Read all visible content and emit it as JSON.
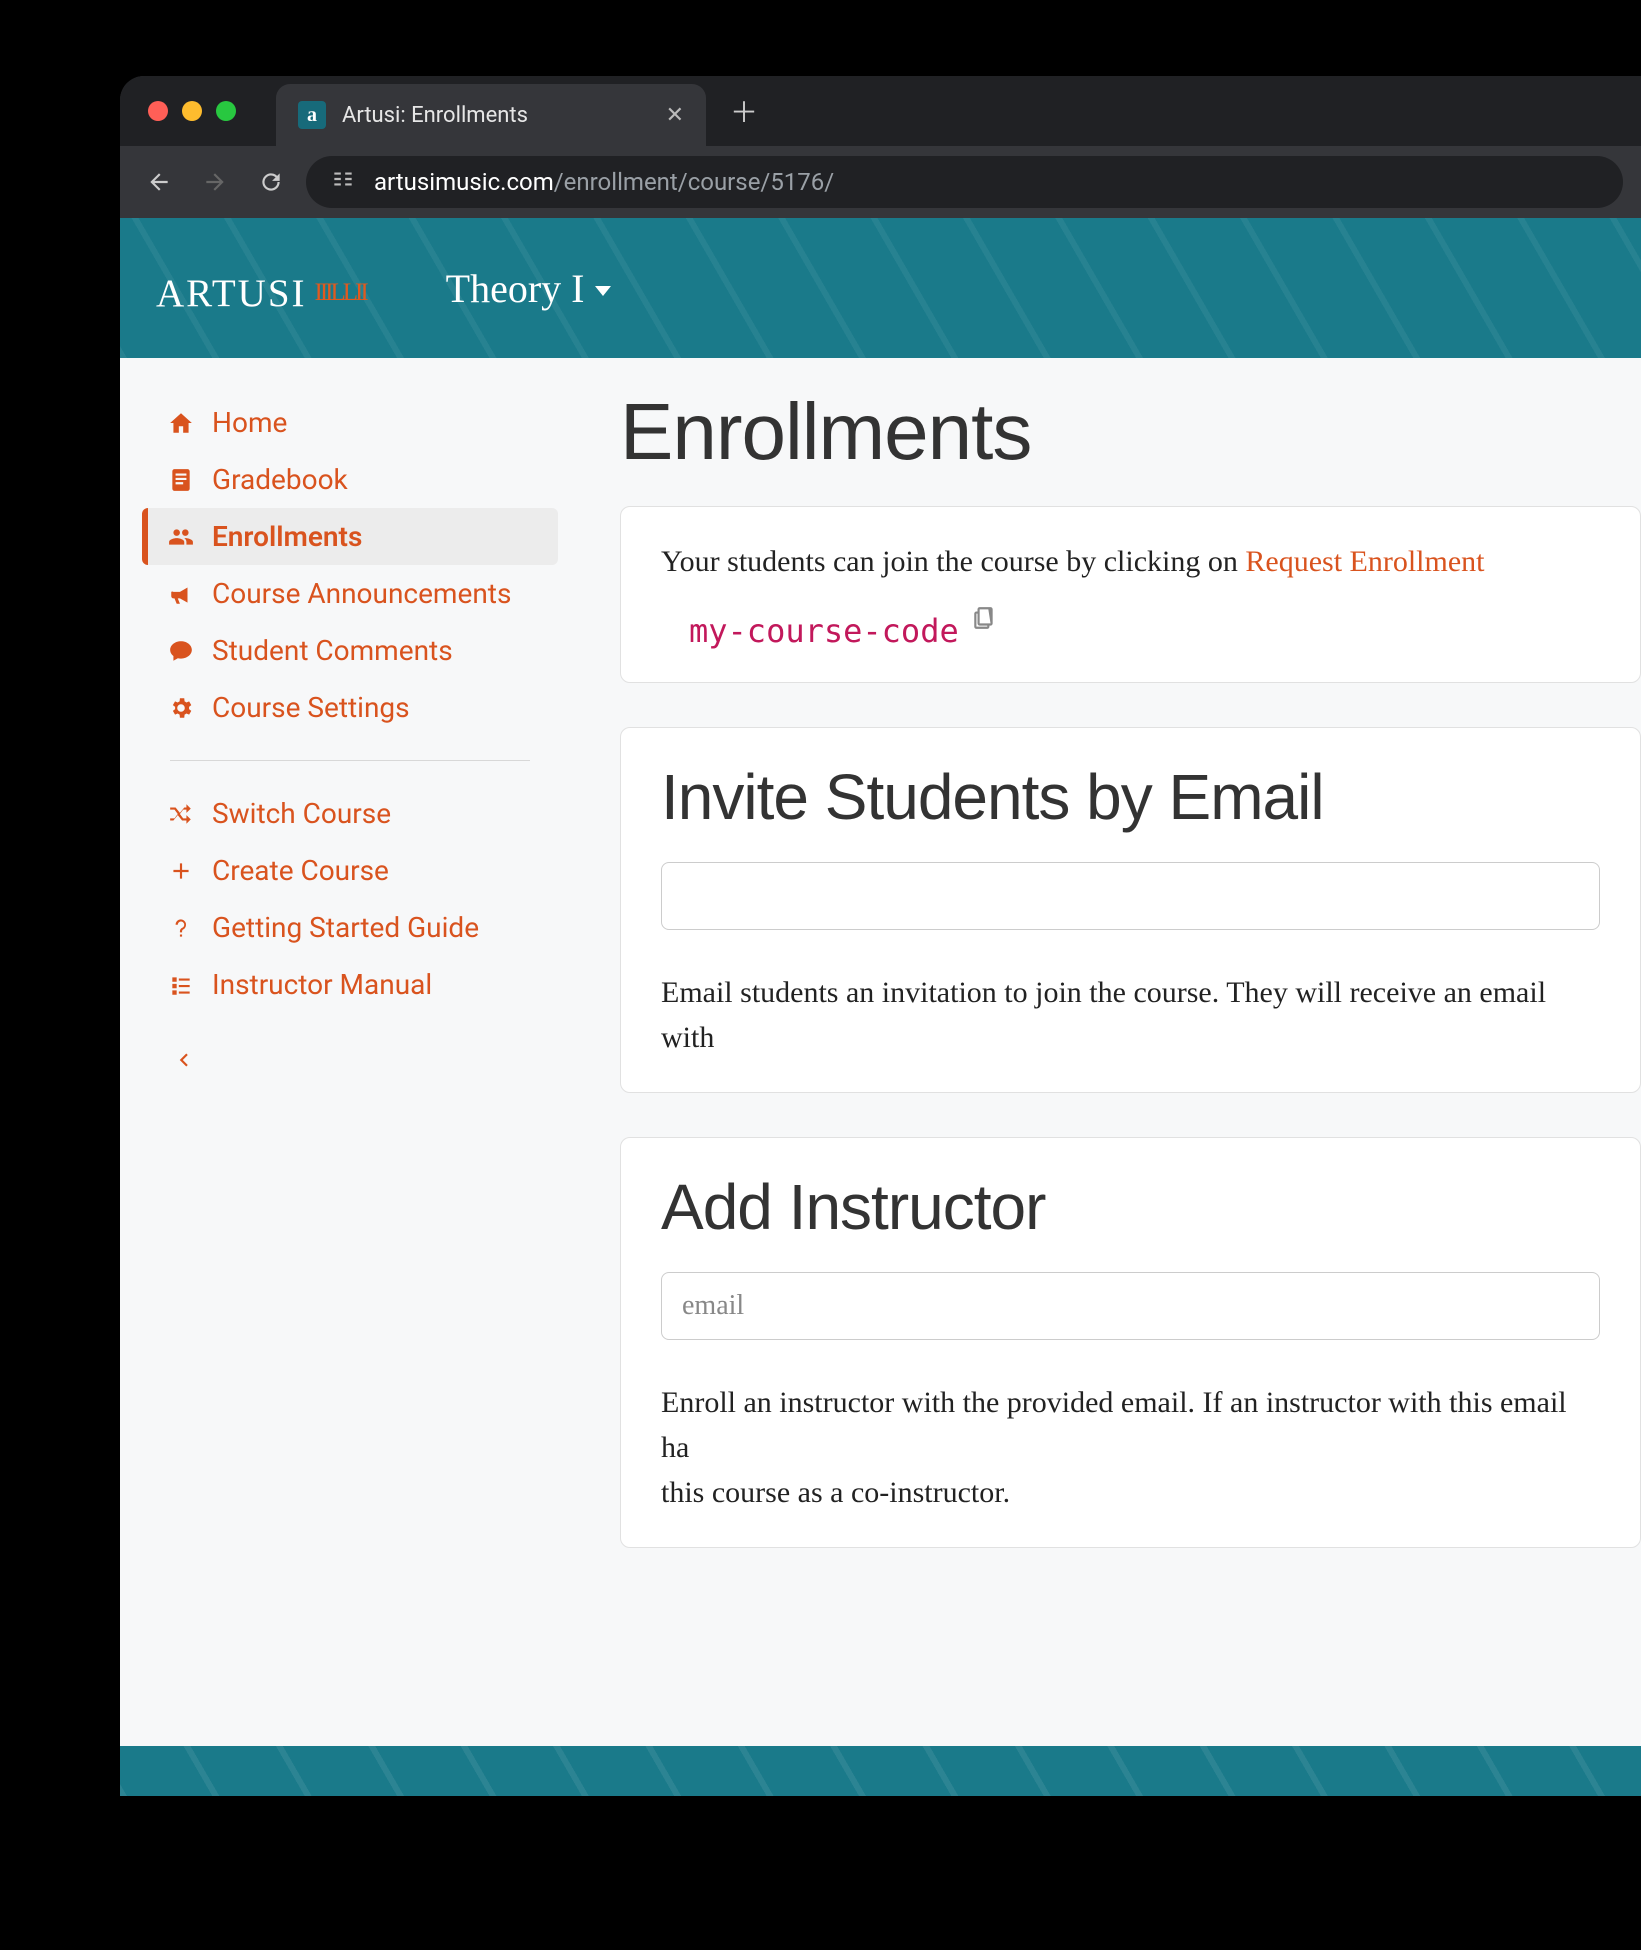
{
  "browser": {
    "tab_title": "Artusi: Enrollments",
    "favicon_letter": "a",
    "url_domain": "artusimusic.com",
    "url_path": "/enrollment/course/5176/"
  },
  "header": {
    "brand": "artusi",
    "course_name": "Theory I"
  },
  "sidebar": {
    "items": [
      {
        "id": "home",
        "label": "Home"
      },
      {
        "id": "gradebook",
        "label": "Gradebook"
      },
      {
        "id": "enrollments",
        "label": "Enrollments"
      },
      {
        "id": "announcements",
        "label": "Course Announcements"
      },
      {
        "id": "comments",
        "label": "Student Comments"
      },
      {
        "id": "settings",
        "label": "Course Settings"
      }
    ],
    "items2": [
      {
        "id": "switch",
        "label": "Switch Course"
      },
      {
        "id": "create",
        "label": "Create Course"
      },
      {
        "id": "guide",
        "label": "Getting Started Guide"
      },
      {
        "id": "manual",
        "label": "Instructor Manual"
      }
    ],
    "active_id": "enrollments"
  },
  "main": {
    "page_title": "Enrollments",
    "enroll_card": {
      "prose_prefix": "Your students can join the course by clicking on ",
      "prose_link": "Request Enrollment",
      "course_code": "my-course-code"
    },
    "invite_card": {
      "title": "Invite Students by Email",
      "desc": "Email students an invitation to join the course. They will receive an email with"
    },
    "instructor_card": {
      "title": "Add Instructor",
      "placeholder": "email",
      "desc1": "Enroll an instructor with the provided email. If an instructor with this email ha",
      "desc2": "this course as a co-instructor."
    }
  }
}
